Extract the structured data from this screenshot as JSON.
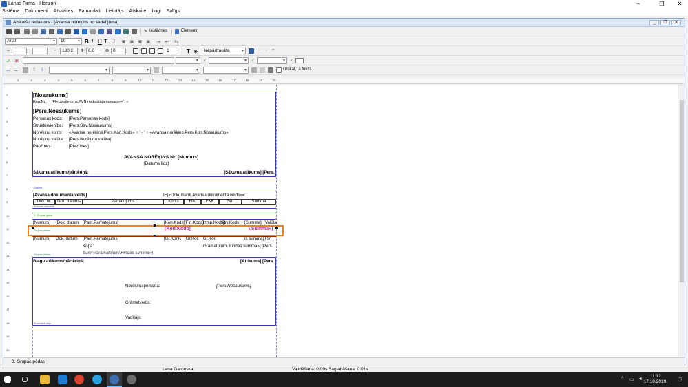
{
  "window": {
    "title": "Lanas Firma - Horizon",
    "minimize": "–",
    "maximize": "❐",
    "close": "✕"
  },
  "menu": [
    "Sistēma",
    "Dokumenti",
    "Atskaites",
    "Pamatdati",
    "Lietotājs",
    "Atskaite",
    "Logi",
    "Palīgs"
  ],
  "child": {
    "title": "Atskaišu redaktors - [Avansa norēķins no sadalījuma]"
  },
  "toolbar1": {
    "settings_label": "Iestādnes",
    "elements_label": "Elementi"
  },
  "toolbar2": {
    "font": "Arial",
    "size": "10"
  },
  "toolbar3": {
    "val1": "",
    "val2": "180.2",
    "val3": "6.6",
    "val4": "0",
    "val5": "1",
    "nepartraukta": "Nepārtraukta"
  },
  "toolbar5": {
    "drukat_label": "Drukāt, ja tukšs"
  },
  "ruler": [
    "1",
    "2",
    "3",
    "4",
    "5",
    "6",
    "7",
    "8",
    "9",
    "10",
    "11",
    "12",
    "13",
    "14",
    "15",
    "16",
    "17",
    "18",
    "19",
    "20"
  ],
  "linenums": [
    "1",
    "2",
    "3",
    "4",
    "5",
    "6",
    "7",
    "8",
    "9",
    "10",
    "11",
    "12",
    "13",
    "14",
    "15",
    "16",
    "17",
    "18",
    "19",
    "20"
  ],
  "report": {
    "nosaukums": "[Nosaukums]",
    "reg_label": "Reģ.Nr.",
    "reg_value": "IF(«Uzņēmums.PVN maksātāja numurs»='', «",
    "pers_nosaukums": "[Pers.Nosaukums]",
    "personas_kods_label": "Personas kods:",
    "personas_kods_value": "[Pers.Personas kods]",
    "struktur_label": "Struktūrvienība:",
    "struktur_value": "[Pers.Strv.Nosaukums]",
    "norekinu_konts_label": "Norēķinu konts:",
    "norekinu_konts_value": "«Avansa norēķins.Pers.Kon.Kods» + ' - ' + «Avansa norēķins.Pers.Kon.Nosaukums»",
    "norekinu_valuta_label": "Norēķinu valūta:",
    "norekinu_valuta_value": "[Pers.Norēķinu valūta]",
    "piezimes_label": "Piezīmes:",
    "piezimes_value": "[Piezīmes]",
    "avansa_title": "AVANSA NORĒĶINS Nr.  [Numurs]",
    "datums": "[Datums līdz]",
    "sakuma_label": "Sākuma atlikums/pārtēriņš:",
    "sakuma_value": "[Sākuma atlikums] [Pers.",
    "dati_label": "Datiem",
    "avansa_dok_veids": "[Avansa dokumenta veids]",
    "if_dok_veids": "IF(«Dokumenti.Avansa dokumenta veids»='",
    "headers": [
      "Dok. nr.",
      "Dok. datums",
      "Pamatojums",
      "Konts",
      "Fin.",
      "EKK",
      "Str.",
      "Summa"
    ],
    "kolonnu_label": "Kolonnu virsraksti",
    "grupas_galva_label": "2. Grupas galva",
    "row1": [
      "[Numurs]",
      "[Dok. datum",
      "[Pam.Pamatojums]",
      "[Kon.Kods]",
      "[Fin.Kods]",
      "[Izmp.Kods]",
      "[Strv.Kods",
      "[Summa]",
      "[Valūta"
    ],
    "sel_kon": "[Kon.Kods]",
    "sel_summa": "ı.Summa»)",
    "grupas_pedas_label": "Grupas pēdas",
    "row2": [
      "[Numurs]",
      "Dok. datum",
      "[Pam.Pamatojums]",
      "[Gr.Kor.K",
      "[Gr.Kor.",
      "[Gr.Kor.",
      "is summa]",
      "[Rin"
    ],
    "kopa_label": "Kopā:",
    "kopa_value": "Grāmatojumi.Rindas summa»] [Pers.",
    "sum_formula": "Sum(«Grāmatojumi.Rindas summa»)",
    "grupas_pedas2_label": "Grupas pēdas",
    "beigu_label": "Beigu atlikums/pārtēriņš:",
    "beigu_value": "[Atlikums] [Pers",
    "norekinu_persona_label": "Norēķinu persona:",
    "norekinu_persona_value": "[Pers.Nosaukums]",
    "gramatvedis_label": "Grāmatvedis:",
    "vaditajs_label": "Vadītājs:",
    "summaru_label": "Summārā daļa"
  },
  "status_left": "2. Grupas pēdas",
  "statusbar": {
    "user": "Lana Garonska",
    "timing": "Validēšana: 0:00s  Saglabāšana: 0:01s"
  },
  "taskbar": {
    "time": "11:12",
    "date": "17.10.2019."
  },
  "colors": {
    "band": "#3a3ab8",
    "selection": "#f07f1e",
    "magenta": "#c8238c",
    "group": "#2e8b2e"
  }
}
